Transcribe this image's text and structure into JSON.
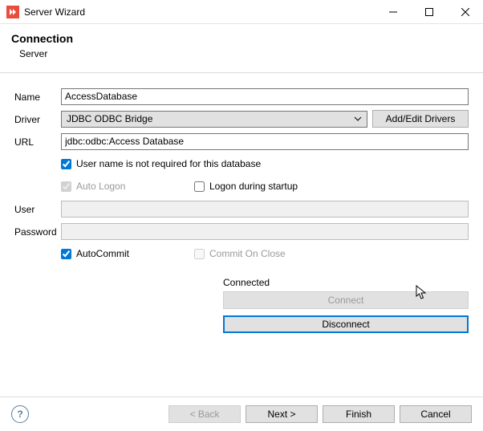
{
  "window": {
    "title": "Server Wizard"
  },
  "header": {
    "title": "Connection",
    "subtitle": "Server"
  },
  "form": {
    "name_label": "Name",
    "name_value": "AccessDatabase",
    "driver_label": "Driver",
    "driver_value": "JDBC ODBC Bridge",
    "add_edit_drivers": "Add/Edit Drivers",
    "url_label": "URL",
    "url_value": "jdbc:odbc:Access Database",
    "no_user_required": "User name is not required for this database",
    "auto_logon": "Auto Logon",
    "logon_during_startup": "Logon during startup",
    "user_label": "User",
    "user_value": "",
    "password_label": "Password",
    "password_value": "",
    "autocommit": "AutoCommit",
    "commit_on_close": "Commit On Close"
  },
  "status": {
    "label": "Connected",
    "connect": "Connect",
    "disconnect": "Disconnect"
  },
  "footer": {
    "back": "< Back",
    "next": "Next >",
    "finish": "Finish",
    "cancel": "Cancel"
  }
}
